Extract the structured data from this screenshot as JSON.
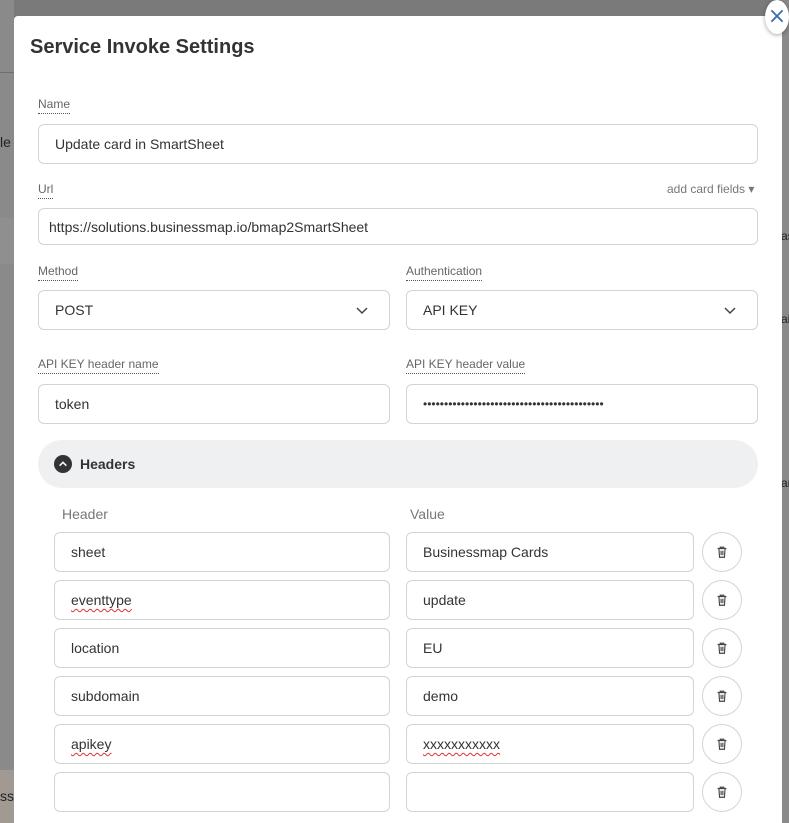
{
  "background": {
    "left_fragments": [
      "le",
      "ss"
    ],
    "right_fragments": [
      "as",
      "ai",
      "ar"
    ]
  },
  "modal": {
    "title": "Service Invoke Settings",
    "close_glyph": "×"
  },
  "form": {
    "name": {
      "label": "Name",
      "value": "Update card in SmartSheet"
    },
    "url": {
      "label": "Url",
      "value": "https://solutions.businessmap.io/bmap2SmartSheet",
      "add_fields_link": "add card fields ▾"
    },
    "method": {
      "label": "Method",
      "value": "POST"
    },
    "authentication": {
      "label": "Authentication",
      "value": "API KEY"
    },
    "api_key_name": {
      "label": "API KEY header name",
      "value": "token"
    },
    "api_key_value": {
      "label": "API KEY header value",
      "value": "•••••••••••••••••••••••••••••••••••••••••••"
    }
  },
  "headers": {
    "title": "Headers",
    "col_header": "Header",
    "col_value": "Value",
    "rows": [
      {
        "key": "sheet",
        "value": "Businessmap Cards"
      },
      {
        "key": "eventtype",
        "value": "update"
      },
      {
        "key": "location",
        "value": "EU"
      },
      {
        "key": "subdomain",
        "value": "demo"
      },
      {
        "key": "apikey",
        "value": "xxxxxxxxxxx"
      },
      {
        "key": "",
        "value": ""
      }
    ]
  },
  "colors": {
    "accent": "#3b6fb0",
    "overlay": "#7a7a7a",
    "headers_bar": "#eef0f2"
  }
}
